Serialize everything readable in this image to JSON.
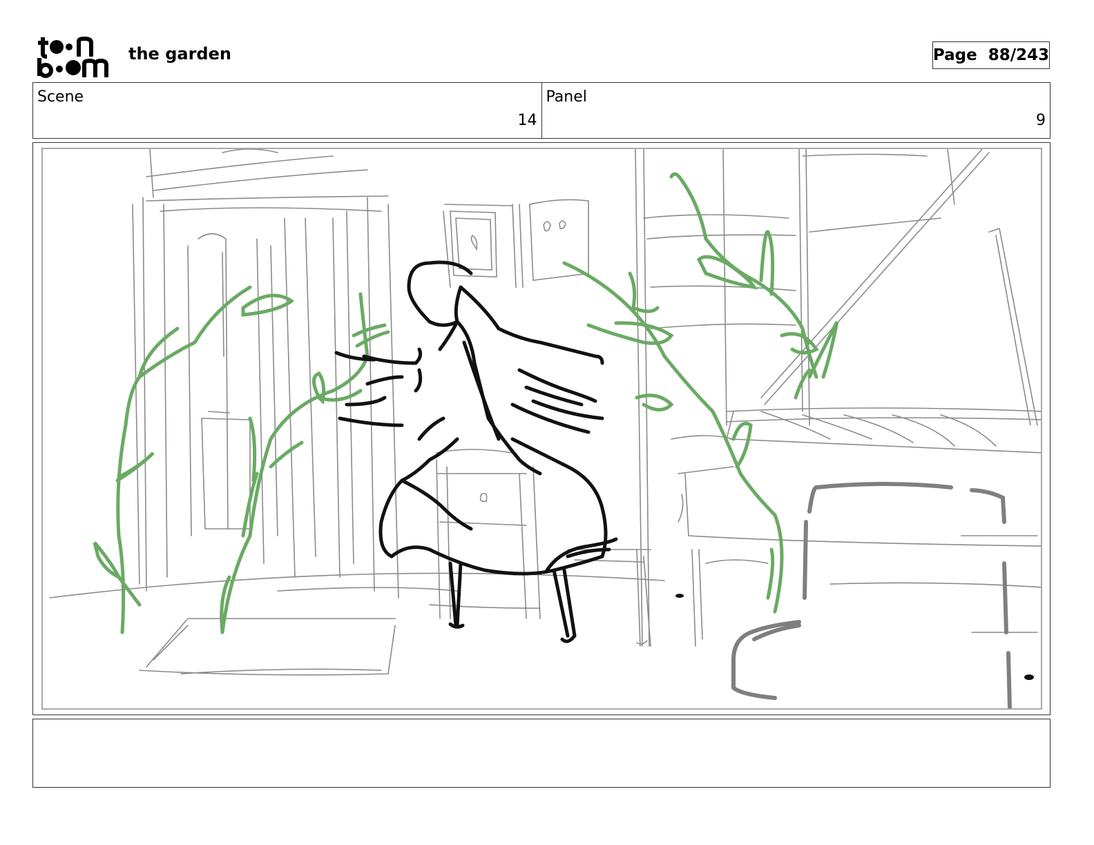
{
  "header": {
    "logo_text": "toon boom",
    "project_title": "the garden",
    "page_label": "Page",
    "page_number": "88/243"
  },
  "info": {
    "scene_label": "Scene",
    "scene_value": "14",
    "panel_label": "Panel",
    "panel_value": "9"
  },
  "notes": {
    "text": ""
  },
  "colors": {
    "sketch_gray": "#8a8a8a",
    "vine_green": "#6aaa64",
    "figure_black": "#111111"
  }
}
